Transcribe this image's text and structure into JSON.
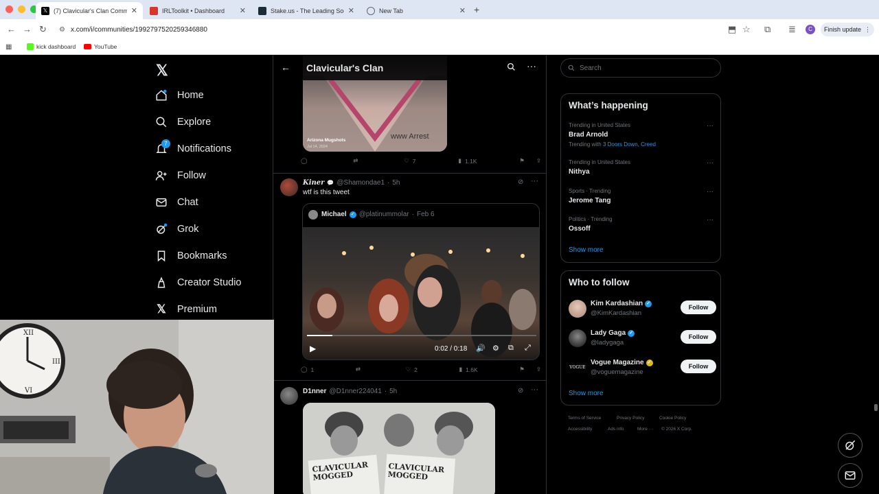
{
  "browser": {
    "tabs": [
      {
        "title": "(7) Clavicular's Clan Commun",
        "active": true
      },
      {
        "title": "IRLToolkit • Dashboard",
        "active": false
      },
      {
        "title": "Stake.us - The Leading Soci",
        "active": false
      },
      {
        "title": "New Tab",
        "active": false
      }
    ],
    "url": "x.com/i/communities/1992797520259346880",
    "finish_update": "Finish update",
    "profile_initial": "C",
    "bookmarks": [
      "kick dashboard",
      "YouTube"
    ]
  },
  "nav": {
    "items": [
      "Home",
      "Explore",
      "Notifications",
      "Follow",
      "Chat",
      "Grok",
      "Bookmarks",
      "Creator Studio",
      "Premium"
    ],
    "notification_count": "7"
  },
  "header": {
    "title": "Clavicular's Clan"
  },
  "tweets": [
    {
      "image_caption": "Arizona Mugshots",
      "image_date": "Jul 14, 2024",
      "image_watermark": "www Arrest",
      "replies": "",
      "retweets": "",
      "likes": "7",
      "views": "1.1K"
    },
    {
      "name": "𝑲𝒊𝒏𝒆𝒓",
      "handle": "@Shamondae1",
      "time": "5h",
      "text": "wtf is this tweet",
      "quote": {
        "name": "Michael",
        "handle": "@platinummolar",
        "date": "Feb 6",
        "video_time": "0:02 / 0:18"
      },
      "replies": "1",
      "retweets": "",
      "likes": "2",
      "views": "1.6K"
    },
    {
      "name": "D1nner",
      "handle": "@D1nner224041",
      "time": "5h",
      "image_text_1": "CLAVICULAR MOGGED",
      "image_text_2": "CLAVICULAR MOGGED"
    }
  ],
  "search": {
    "placeholder": "Search"
  },
  "happening": {
    "title": "What’s happening",
    "trends": [
      {
        "meta": "Trending in United States",
        "name": "Brad Arnold",
        "with_label": "Trending with",
        "with": "3 Doors Down, Creed"
      },
      {
        "meta": "Trending in United States",
        "name": "Nithya"
      },
      {
        "meta": "Sports · Trending",
        "name": "Jerome Tang"
      },
      {
        "meta": "Politics · Trending",
        "name": "Ossoff"
      }
    ],
    "show_more": "Show more"
  },
  "who_to_follow": {
    "title": "Who to follow",
    "accounts": [
      {
        "name": "Kim Kardashian",
        "handle": "@KimKardashian",
        "badge": "blue"
      },
      {
        "name": "Lady Gaga",
        "handle": "@ladygaga",
        "badge": "blue"
      },
      {
        "name": "Vogue Magazine",
        "handle": "@voguemagazine",
        "badge": "gold"
      }
    ],
    "follow_label": "Follow",
    "show_more": "Show more"
  },
  "footer": {
    "links": [
      "Terms of Service",
      "Privacy Policy",
      "Cookie Policy",
      "Accessibility",
      "Ads info",
      "More ···",
      "© 2026 X Corp."
    ]
  },
  "colors": {
    "accent": "#1d9bf0",
    "background": "#000000",
    "border": "#2f3336",
    "muted": "#71767b",
    "gold": "#e2b719"
  }
}
